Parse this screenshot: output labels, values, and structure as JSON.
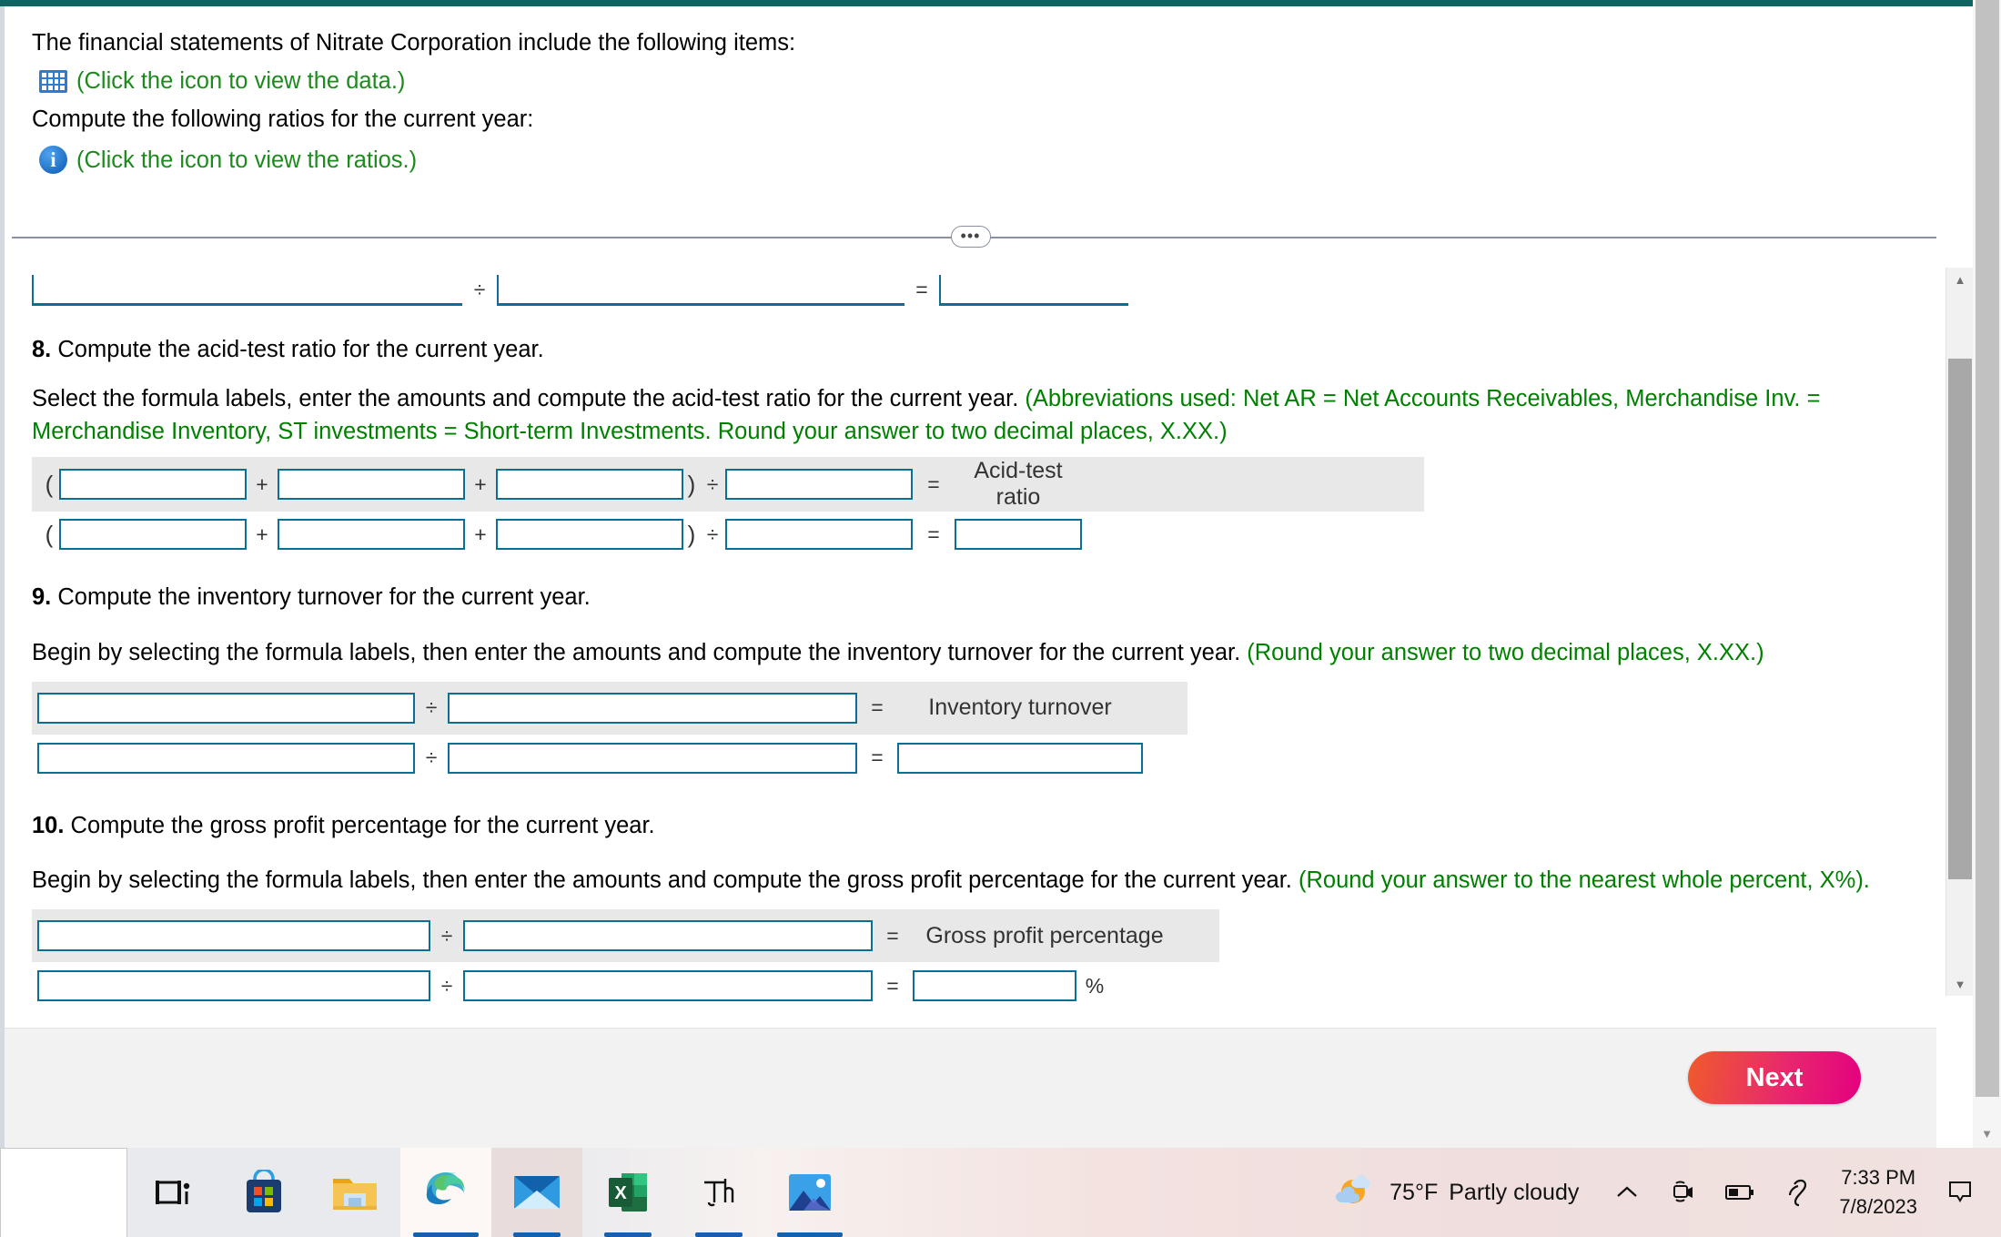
{
  "header": {
    "intro": "The financial statements of Nitrate Corporation include the following items:",
    "data_link": "(Click the icon to view the data.)",
    "data_icon": "grid-table-icon",
    "compute_line": "Compute the following ratios for the current year:",
    "ratios_link": "(Click the icon to view the ratios.)",
    "ratios_icon": "info-circle-icon"
  },
  "divider": {
    "handle": "•••"
  },
  "operators": {
    "divide": "÷",
    "equals": "=",
    "plus": "+",
    "lparen": "(",
    "rparen": ")",
    "percent": "%"
  },
  "top_formula": {
    "fields": [
      "",
      "",
      ""
    ]
  },
  "question8": {
    "number": "8.",
    "title": "Compute the acid-test ratio for the current year.",
    "instruction_black": "Select the formula labels, enter the amounts and compute the acid-test ratio for the current year. ",
    "instruction_green": "(Abbreviations used: Net AR = Net Accounts Receivables, Merchandise Inv. = Merchandise Inventory, ST investments = Short-term Investments. Round your answer to two decimal places, X.XX.)",
    "result_label": "Acid-test ratio",
    "result_label_line1": "Acid-test",
    "result_label_line2": "ratio",
    "row1_fields": [
      "",
      "",
      "",
      ""
    ],
    "row2_fields": [
      "",
      "",
      "",
      "",
      ""
    ]
  },
  "question9": {
    "number": "9.",
    "title": "Compute the inventory turnover for the current year.",
    "instruction_black": "Begin by selecting the formula labels, then enter the amounts and compute the inventory turnover for the current year. ",
    "instruction_green": "(Round your answer to two decimal places, X.XX.)",
    "result_label": "Inventory turnover",
    "row1_fields": [
      "",
      ""
    ],
    "row2_fields": [
      "",
      "",
      ""
    ]
  },
  "question10": {
    "number": "10.",
    "title": "Compute the gross profit percentage for the current year.",
    "instruction_black": "Begin by selecting the formula labels, then enter the amounts and compute the gross profit percentage for the current year. ",
    "instruction_green": "(Round your answer to the nearest whole percent, X%).",
    "result_label": "Gross profit percentage",
    "row1_fields": [
      "",
      ""
    ],
    "row2_fields": [
      "",
      "",
      ""
    ]
  },
  "footer": {
    "next_label": "Next"
  },
  "scrollbars": {
    "inner_up": "▲",
    "inner_down": "▼",
    "outer_down": "▼"
  },
  "taskbar": {
    "items": [
      {
        "name": "task-view-icon",
        "label": "Task View"
      },
      {
        "name": "microsoft-store-icon",
        "label": "Microsoft Store"
      },
      {
        "name": "file-explorer-icon",
        "label": "File Explorer"
      },
      {
        "name": "microsoft-edge-icon",
        "label": "Microsoft Edge"
      },
      {
        "name": "mail-icon",
        "label": "Mail"
      },
      {
        "name": "excel-icon",
        "label": "Excel"
      },
      {
        "name": "thesaurus-icon",
        "label": "Th"
      },
      {
        "name": "photos-icon",
        "label": "Photos"
      }
    ],
    "excel_glyph": "X",
    "thesaurus_glyph": "Th"
  },
  "tray": {
    "weather_temp": "75°F",
    "weather_desc": "Partly cloudy",
    "weather_icon": "partly-cloudy-icon",
    "chevron": "∧",
    "time": "7:33 PM",
    "date": "7/8/2023"
  },
  "colors": {
    "top_bar": "#106461",
    "field_border": "#0d6e93",
    "green_text": "#008000",
    "row_highlight": "#e8e8e8",
    "next_gradient_start": "#ef5b2b",
    "next_gradient_end": "#e3007f"
  }
}
